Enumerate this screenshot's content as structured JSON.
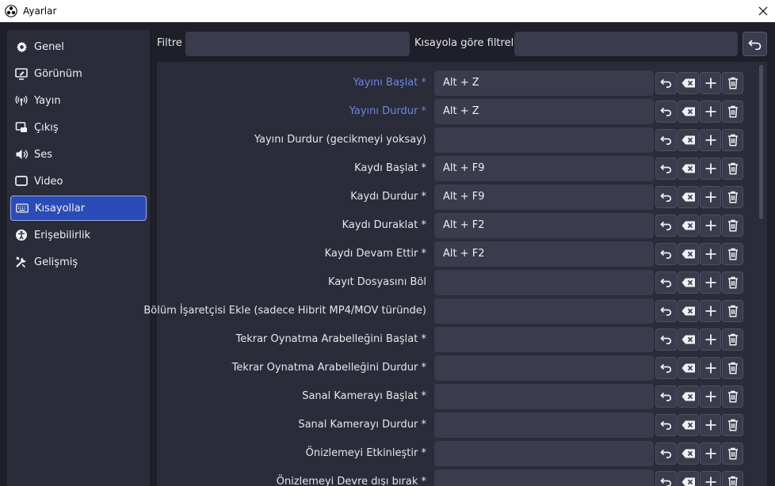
{
  "window": {
    "title": "Ayarlar"
  },
  "sidebar": {
    "items": [
      {
        "label": "Genel",
        "icon": "gear-icon",
        "active": false
      },
      {
        "label": "Görünüm",
        "icon": "appearance-icon",
        "active": false
      },
      {
        "label": "Yayın",
        "icon": "broadcast-icon",
        "active": false
      },
      {
        "label": "Çıkış",
        "icon": "output-icon",
        "active": false
      },
      {
        "label": "Ses",
        "icon": "speaker-icon",
        "active": false
      },
      {
        "label": "Video",
        "icon": "monitor-icon",
        "active": false
      },
      {
        "label": "Kısayollar",
        "icon": "keyboard-icon",
        "active": true
      },
      {
        "label": "Erişebilirlik",
        "icon": "accessibility-icon",
        "active": false
      },
      {
        "label": "Gelişmiş",
        "icon": "tools-icon",
        "active": false
      }
    ]
  },
  "filters": {
    "filter_label": "Filtre",
    "filter_value": "",
    "shortcut_filter_label": "Kısayola göre filtrele",
    "shortcut_filter_value": ""
  },
  "hotkeys": [
    {
      "label": "Yayını Başlat *",
      "value": "Alt + Z",
      "accent": true
    },
    {
      "label": "Yayını Durdur *",
      "value": "Alt + Z",
      "accent": true
    },
    {
      "label": "Yayını Durdur (gecikmeyi yoksay)",
      "value": "",
      "accent": false
    },
    {
      "label": "Kaydı Başlat *",
      "value": "Alt + F9",
      "accent": false
    },
    {
      "label": "Kaydı Durdur *",
      "value": "Alt + F9",
      "accent": false
    },
    {
      "label": "Kaydı Duraklat *",
      "value": "Alt + F2",
      "accent": false
    },
    {
      "label": "Kaydı Devam Ettir *",
      "value": "Alt + F2",
      "accent": false
    },
    {
      "label": "Kayıt Dosyasını Böl",
      "value": "",
      "accent": false
    },
    {
      "label": "Bölüm İşaretçisi Ekle (sadece Hibrit MP4/MOV türünde)",
      "value": "",
      "accent": false
    },
    {
      "label": "Tekrar Oynatma Arabelleğini Başlat *",
      "value": "",
      "accent": false
    },
    {
      "label": "Tekrar Oynatma Arabelleğini Durdur *",
      "value": "",
      "accent": false
    },
    {
      "label": "Sanal Kamerayı Başlat *",
      "value": "",
      "accent": false
    },
    {
      "label": "Sanal Kamerayı Durdur *",
      "value": "",
      "accent": false
    },
    {
      "label": "Önizlemeyi Etkinleştir *",
      "value": "",
      "accent": false
    },
    {
      "label": "Önizlemeyi Devre dışı bırak *",
      "value": "",
      "accent": false
    }
  ],
  "colors": {
    "accent": "#2b4bb7",
    "accent_text": "#6b86e0",
    "background": "#1e1f29",
    "panel": "#2b2c39",
    "input": "#3a3b4c"
  }
}
